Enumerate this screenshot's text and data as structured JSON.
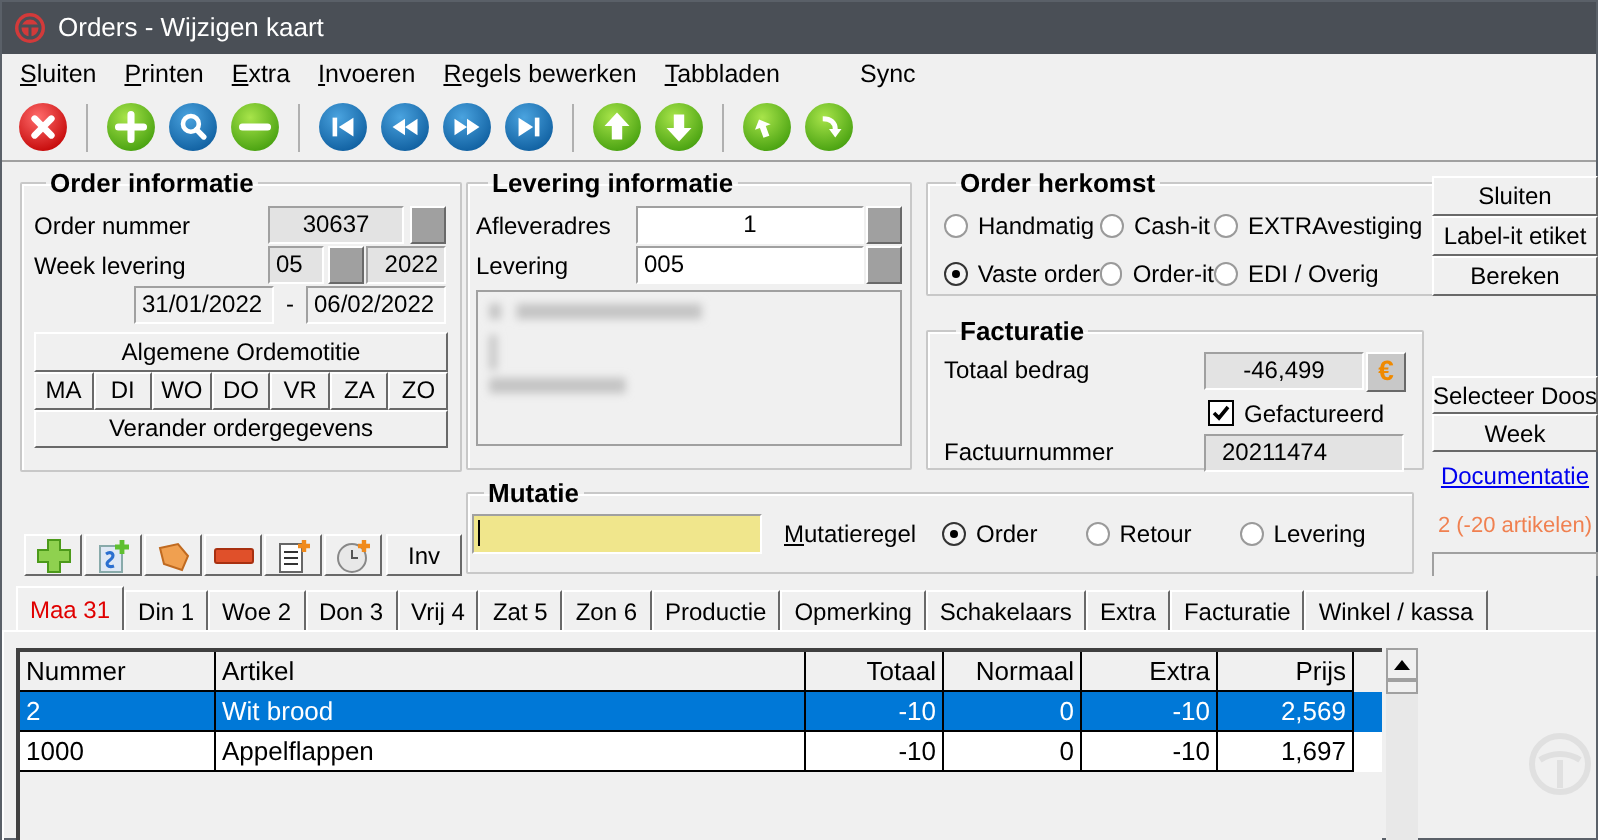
{
  "window": {
    "title": "Orders - Wijzigen kaart"
  },
  "menu": [
    {
      "label": "Sluiten",
      "underline_first": true
    },
    {
      "label": "Printen",
      "underline_first": true
    },
    {
      "label": "Extra",
      "underline_first": true
    },
    {
      "label": "Invoeren",
      "underline_first": true
    },
    {
      "label": "Regels bewerken",
      "underline_first": true
    },
    {
      "label": "Tabbladen",
      "underline_first": true
    },
    {
      "label": "Sync",
      "underline_first": false
    }
  ],
  "toolbar": [
    [
      {
        "kind": "close"
      }
    ],
    [
      {
        "kind": "add"
      },
      {
        "kind": "search"
      },
      {
        "kind": "remove"
      }
    ],
    [
      {
        "kind": "first"
      },
      {
        "kind": "prev"
      },
      {
        "kind": "next"
      },
      {
        "kind": "last"
      }
    ],
    [
      {
        "kind": "up"
      },
      {
        "kind": "down"
      }
    ],
    [
      {
        "kind": "undo"
      },
      {
        "kind": "redo"
      }
    ]
  ],
  "order_info": {
    "title": "Order informatie",
    "order_number": {
      "label": "Order nummer",
      "value": "30637"
    },
    "week": {
      "label": "Week levering",
      "week": "05",
      "year": "2022"
    },
    "dates": {
      "from": "31/01/2022",
      "separator": "-",
      "to": "06/02/2022"
    },
    "note_button": "Algemene Ordemotitie",
    "days": [
      "MA",
      "DI",
      "WO",
      "DO",
      "VR",
      "ZA",
      "ZO"
    ],
    "change_button": "Verander ordergegevens"
  },
  "delivery": {
    "title": "Levering informatie",
    "address": {
      "label": "Afleveradres",
      "value": "1"
    },
    "delivery": {
      "label": "Levering",
      "value": "005"
    }
  },
  "origin": {
    "title": "Order herkomst",
    "options": [
      {
        "label": "Handmatig",
        "selected": false
      },
      {
        "label": "Cash-it",
        "selected": false
      },
      {
        "label": "EXTRAvestiging",
        "selected": false
      },
      {
        "label": "Vaste order",
        "selected": true
      },
      {
        "label": "Order-it",
        "selected": false
      },
      {
        "label": "EDI / Overig",
        "selected": false
      }
    ]
  },
  "invoicing": {
    "title": "Facturatie",
    "total": {
      "label": "Totaal bedrag",
      "value": "-46,499",
      "button": "€"
    },
    "invoiced": {
      "label": "Gefactureerd",
      "checked": true
    },
    "invoice_number": {
      "label": "Factuurnummer",
      "value": "20211474"
    }
  },
  "side_buttons": [
    "Sluiten",
    "Label-it etiket",
    "Bereken"
  ],
  "side_buttons_2": [
    "Selecteer Doos",
    "Week"
  ],
  "documentation_link": "Documentatie",
  "article_count": "2 (-20 artikelen)",
  "mutation": {
    "title": "Mutatie",
    "label": "Mutatieregel",
    "options": [
      {
        "label": "Order",
        "selected": true
      },
      {
        "label": "Retour",
        "selected": false
      },
      {
        "label": "Levering",
        "selected": false
      }
    ]
  },
  "line_tools": [
    {
      "kind": "add"
    },
    {
      "kind": "add-s"
    },
    {
      "kind": "tag"
    },
    {
      "kind": "remove"
    },
    {
      "kind": "list-add"
    },
    {
      "kind": "clock-add"
    },
    {
      "kind": "text",
      "label": "Inv"
    }
  ],
  "tabs": [
    {
      "label": "Maa 31",
      "selected": true
    },
    {
      "label": "Din 1",
      "selected": false
    },
    {
      "label": "Woe 2",
      "selected": false
    },
    {
      "label": "Don 3",
      "selected": false
    },
    {
      "label": "Vrij 4",
      "selected": false
    },
    {
      "label": "Zat 5",
      "selected": false
    },
    {
      "label": "Zon 6",
      "selected": false
    },
    {
      "label": "Productie",
      "selected": false
    },
    {
      "label": "Opmerking",
      "selected": false
    },
    {
      "label": "Schakelaars",
      "selected": false
    },
    {
      "label": "Extra",
      "selected": false
    },
    {
      "label": "Facturatie",
      "selected": false
    },
    {
      "label": "Winkel / kassa",
      "selected": false
    }
  ],
  "table": {
    "columns": [
      "Nummer",
      "Artikel",
      "Totaal",
      "Normaal",
      "Extra",
      "Prijs"
    ],
    "rows": [
      {
        "cells": [
          "2",
          "Wit brood",
          "-10",
          "0",
          "-10",
          "2,569"
        ],
        "selected": true
      },
      {
        "cells": [
          "1000",
          "Appelflappen",
          "-10",
          "0",
          "-10",
          "1,697"
        ],
        "selected": false
      }
    ]
  }
}
